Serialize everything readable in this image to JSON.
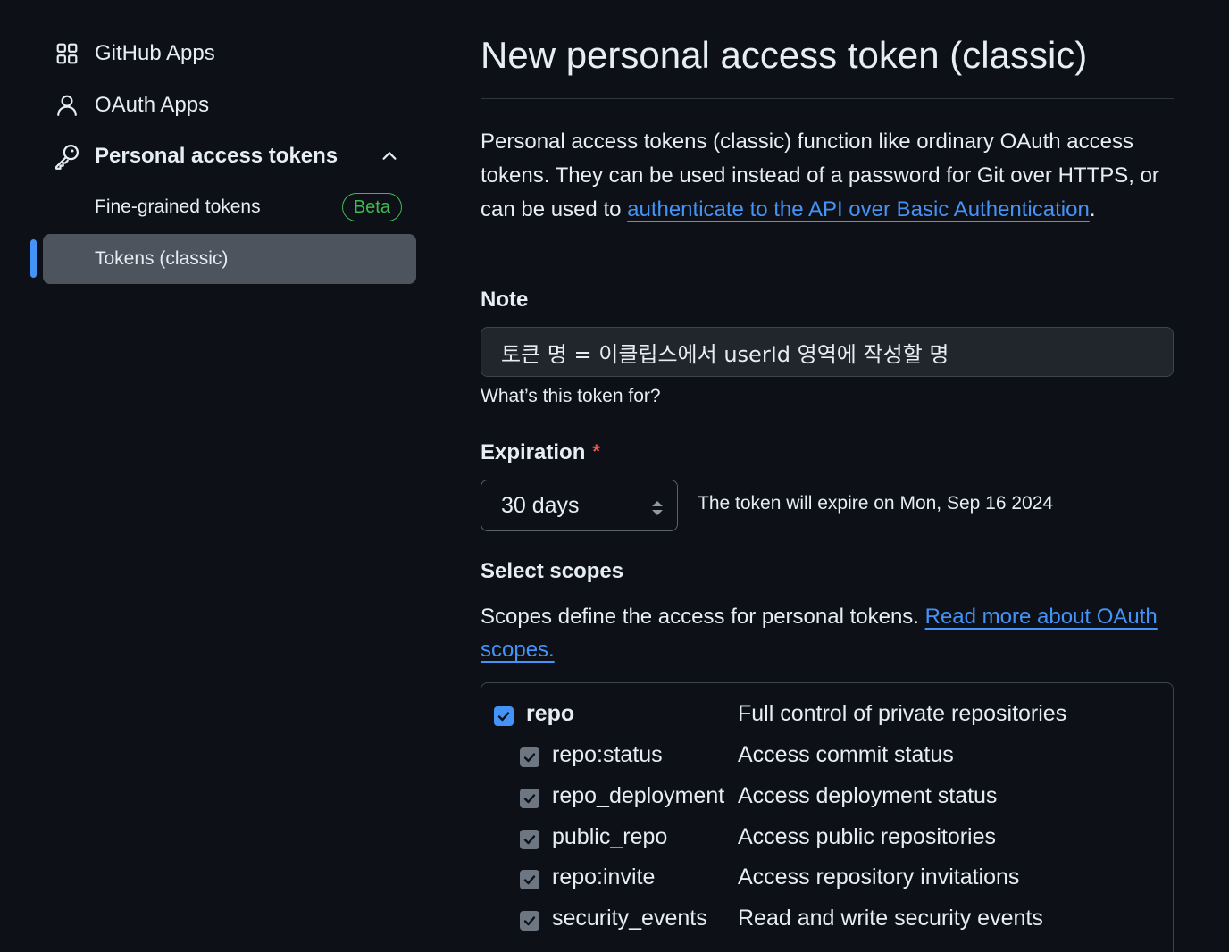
{
  "sidebar": {
    "github_apps": "GitHub Apps",
    "oauth_apps": "OAuth Apps",
    "personal_access_tokens": "Personal access tokens",
    "fine_grained": "Fine-grained tokens",
    "beta": "Beta",
    "tokens_classic": "Tokens (classic)"
  },
  "main": {
    "title": "New personal access token (classic)",
    "desc_part1": "Personal access tokens (classic) function like ordinary OAuth access tokens. They can be used instead of a password for Git over HTTPS, or can be used to ",
    "desc_link": "authenticate to the API over Basic Authentication",
    "desc_end": ".",
    "note_label": "Note",
    "note_value": "토큰 명 = 이클립스에서 userId 영역에 작성할 명",
    "note_hint": "What’s this token for?",
    "expiration_label": "Expiration",
    "required_mark": "*",
    "expiration_value": "30 days",
    "expiration_note": "The token will expire on Mon, Sep 16 2024",
    "scopes_label": "Select scopes",
    "scopes_desc": "Scopes define the access for personal tokens. ",
    "scopes_link": "Read more about OAuth scopes."
  },
  "scopes": [
    {
      "name": "repo",
      "desc": "Full control of private repositories",
      "checked": true,
      "parent": true
    },
    {
      "name": "repo:status",
      "desc": "Access commit status",
      "checked": true,
      "parent": false
    },
    {
      "name": "repo_deployment",
      "desc": "Access deployment status",
      "checked": true,
      "parent": false
    },
    {
      "name": "public_repo",
      "desc": "Access public repositories",
      "checked": true,
      "parent": false
    },
    {
      "name": "repo:invite",
      "desc": "Access repository invitations",
      "checked": true,
      "parent": false
    },
    {
      "name": "security_events",
      "desc": "Read and write security events",
      "checked": true,
      "parent": false
    }
  ],
  "colors": {
    "background": "#0d1117",
    "accent": "#4493f8",
    "beta": "#3fb950",
    "required": "#f85149",
    "active_item": "#4d545e"
  }
}
